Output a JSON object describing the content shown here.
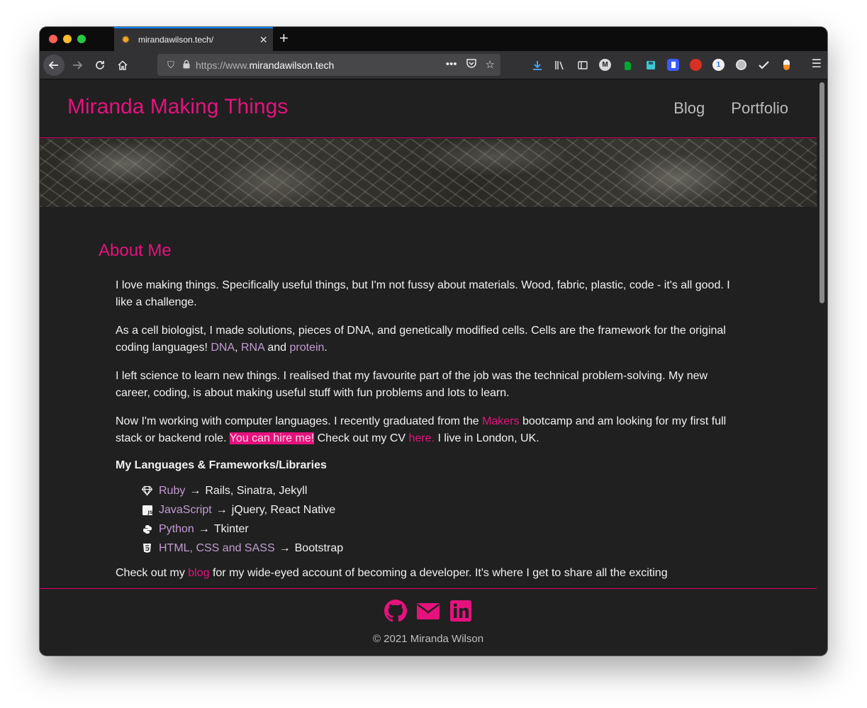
{
  "browser": {
    "tab_title": "mirandawilson.tech/",
    "url_prefix": "https://www.",
    "url_domain": "mirandawilson.tech"
  },
  "site": {
    "title": "Miranda Making Things",
    "nav": {
      "blog": "Blog",
      "portfolio": "Portfolio"
    }
  },
  "about": {
    "heading": "About Me",
    "p1": "I love making things. Specifically useful things, but I'm not fussy about materials. Wood, fabric, plastic, code - it's all good. I like a challenge.",
    "p2_pre": "As a cell biologist, I made solutions, pieces of DNA, and genetically modified cells. Cells are the framework for the original coding languages! ",
    "p2_dna": "DNA",
    "p2_comma": ", ",
    "p2_rna": "RNA",
    "p2_and": " and ",
    "p2_protein": "protein",
    "p2_end": ".",
    "p3": "I left science to learn new things. I realised that my favourite part of the job was the technical problem-solving. My new career, coding, is about making useful stuff with fun problems and lots to learn.",
    "p4_pre": "Now I'm working with computer languages. I recently graduated from the ",
    "p4_makers": "Makers",
    "p4_mid": " bootcamp and am looking for my first full stack or backend role. ",
    "p4_hire": "You can hire me!",
    "p4_cv": " Check out my CV ",
    "p4_here": "here.",
    "p4_end": " I live in London, UK.",
    "languages_heading": "My Languages & Frameworks/Libraries",
    "languages": [
      {
        "icon": "gem-icon",
        "name": "Ruby",
        "arrow": "→",
        "frameworks": "Rails, Sinatra, Jekyll"
      },
      {
        "icon": "js-icon",
        "name": "JavaScript",
        "arrow": "→",
        "frameworks": "jQuery, React Native"
      },
      {
        "icon": "python-icon",
        "name": "Python",
        "arrow": "→",
        "frameworks": "Tkinter"
      },
      {
        "icon": "html5-icon",
        "name": "HTML, CSS and SASS",
        "arrow": "→",
        "frameworks": "Bootstrap"
      }
    ],
    "p5_pre": "Check out my ",
    "p5_blog": "blog",
    "p5_post": " for my wide-eyed account of becoming a developer. It's where I get to share all the exciting"
  },
  "footer": {
    "icons": [
      "github-icon",
      "envelope-icon",
      "linkedin-icon"
    ],
    "copyright": "© 2021 Miranda Wilson"
  },
  "colors": {
    "accent": "#e5127d",
    "link": "#c39bd3",
    "background": "#202020"
  }
}
